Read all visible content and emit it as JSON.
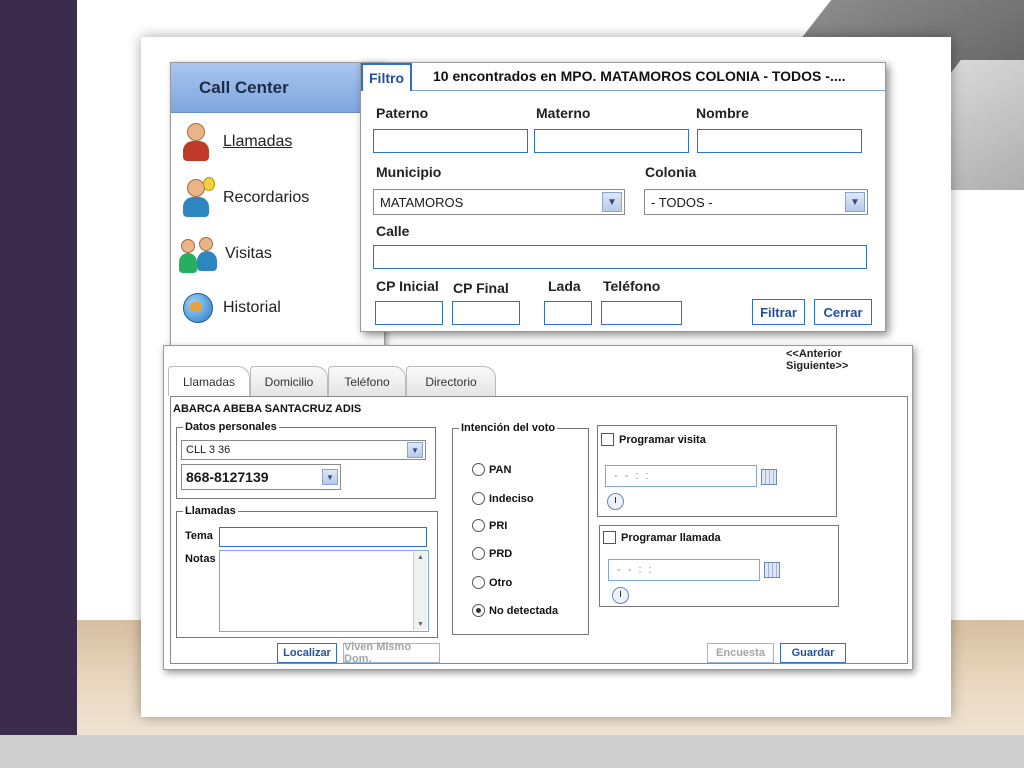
{
  "sidebar": {
    "title": "Call Center",
    "items": [
      {
        "label": "Llamadas"
      },
      {
        "label": "Recordarios"
      },
      {
        "label": "Visitas"
      },
      {
        "label": "Historial"
      }
    ]
  },
  "filter": {
    "tab_label": "Filtro",
    "summary": "10 encontrados en MPO. MATAMOROS COLONIA - TODOS -....",
    "labels": {
      "paterno": "Paterno",
      "materno": "Materno",
      "nombre": "Nombre",
      "municipio": "Municipio",
      "colonia": "Colonia",
      "calle": "Calle",
      "cp_inicial": "CP Inicial",
      "cp_final": "CP Final",
      "lada": "Lada",
      "telefono": "Teléfono"
    },
    "municipio_value": "MATAMOROS",
    "colonia_value": "- TODOS -",
    "filtrar_button": "Filtrar",
    "cerrar_button": "Cerrar"
  },
  "record": {
    "prev_link": "<<Anterior",
    "next_link": "Siguiente>>",
    "tabs": [
      "Llamadas",
      "Domicilio",
      "Teléfono",
      "Directorio"
    ],
    "person_name": "ABARCA ABEBA SANTACRUZ ADIS",
    "datos_personales": {
      "legend": "Datos personales",
      "address_value": "CLL 3 36",
      "phone_value": "868-8127139"
    },
    "llamadas": {
      "legend": "Llamadas",
      "tema_label": "Tema",
      "notas_label": "Notas"
    },
    "intencion": {
      "legend": "Intención del voto",
      "options": [
        "PAN",
        "Indeciso",
        "PRI",
        "PRD",
        "Otro",
        "No detectada"
      ],
      "selected": "No detectada"
    },
    "programar_visita": {
      "label": "Programar visita",
      "date_placeholder": "- -     : :"
    },
    "programar_llamada": {
      "label": "Programar llamada",
      "date_placeholder": "- -     : :"
    },
    "buttons": {
      "localizar": "Localizar",
      "viven": "Viven Mismo Dom.",
      "encuesta": "Encuesta",
      "guardar": "Guardar"
    }
  },
  "colors": {
    "accent": "#2f6fc8",
    "header_blue": "#7ea6df",
    "side_panel": "#3b2c4d"
  }
}
